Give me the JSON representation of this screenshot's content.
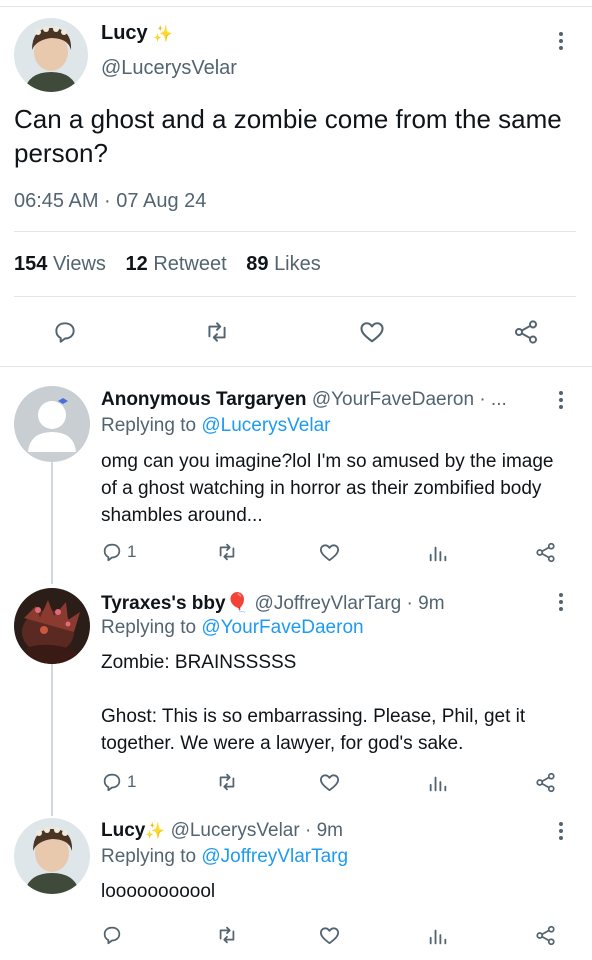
{
  "main_tweet": {
    "name": "Lucy",
    "handle": "@LucerysVelar",
    "text": "Can a ghost and a zombie come from the same person?",
    "time": "06:45 AM · 07 Aug 24",
    "stats": {
      "views_count": "154",
      "views_label": "Views",
      "retweets_count": "12",
      "retweets_label": "Retweet",
      "likes_count": "89",
      "likes_label": "Likes"
    }
  },
  "replies": [
    {
      "name": "Anonymous Targaryen",
      "handle": "@YourFaveDaeron · ...",
      "replying_prefix": "Replying to",
      "replying_to": "@LucerysVelar",
      "text": "omg can you imagine?lol I'm so amused by the image of a ghost watching in horror as their zombified body shambles around...",
      "reply_count": "1"
    },
    {
      "name": "Tyraxes's bby",
      "handle": "@JoffreyVlarTarg · 9m",
      "replying_prefix": "Replying to",
      "replying_to": "@YourFaveDaeron",
      "text_line1": "Zombie: BRAINSSSSS",
      "text_line2": "Ghost: This is so embarrassing. Please, Phil, get it together. We were a lawyer, for god's sake.",
      "reply_count": "1"
    },
    {
      "name": "Lucy",
      "handle": "@LucerysVelar · 9m",
      "replying_prefix": "Replying to",
      "replying_to": "@JoffreyVlarTarg",
      "text": "looooooooool"
    }
  ],
  "colors": {
    "accent": "#1d9bf0",
    "secondary_text": "#536471",
    "divider": "#e1e6ea",
    "like_balloon": "#e0245e",
    "sparkle": "#f5c518"
  }
}
